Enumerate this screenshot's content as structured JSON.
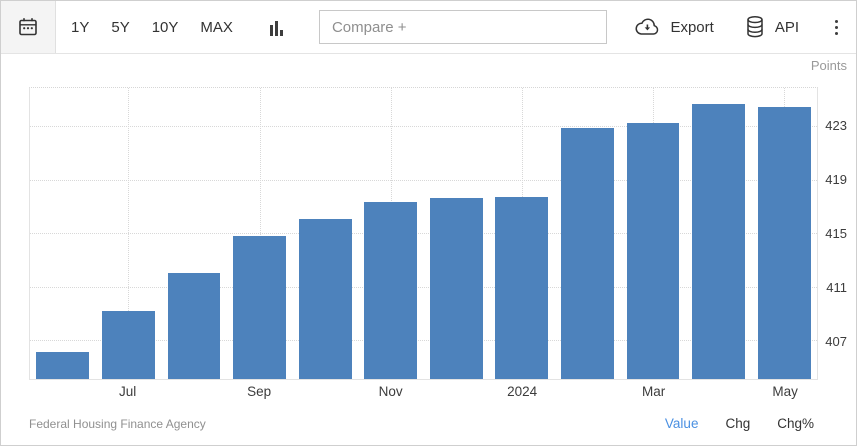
{
  "toolbar": {
    "range_buttons": [
      "1Y",
      "5Y",
      "10Y",
      "MAX"
    ],
    "compare_placeholder": "Compare +",
    "export_label": "Export",
    "api_label": "API"
  },
  "chart_data": {
    "type": "bar",
    "title": "",
    "unit_label": "Points",
    "source": "Federal Housing Finance Agency",
    "categories": [
      "Jun 2023",
      "Jul 2023",
      "Aug 2023",
      "Sep 2023",
      "Oct 2023",
      "Nov 2023",
      "Dec 2023",
      "Jan 2024",
      "Feb 2024",
      "Mar 2024",
      "Apr 2024",
      "May 2024"
    ],
    "values": [
      406.2,
      409.3,
      412.1,
      414.9,
      416.1,
      417.4,
      417.7,
      417.8,
      422.9,
      423.3,
      424.7,
      424.5
    ],
    "x_tick_indices": [
      1,
      3,
      5,
      7,
      9,
      11
    ],
    "x_tick_labels": [
      "Jul",
      "Sep",
      "Nov",
      "2024",
      "Mar",
      "May"
    ],
    "y_ticks": [
      407,
      411,
      415,
      419,
      423
    ],
    "ylim": [
      404.2,
      425.9
    ],
    "grid": "dotted",
    "legend_position": "none",
    "bar_color": "#4d82bc"
  },
  "footer": {
    "source_label": "Federal Housing Finance Agency",
    "links": [
      {
        "label": "Value",
        "active": true
      },
      {
        "label": "Chg",
        "active": false
      },
      {
        "label": "Chg%",
        "active": false
      }
    ]
  },
  "colors": {
    "bar": "#4d82bc",
    "link_active": "#4a90e2",
    "grid": "#d8d8d8",
    "muted_text": "#999999",
    "dark_text": "#333333"
  }
}
